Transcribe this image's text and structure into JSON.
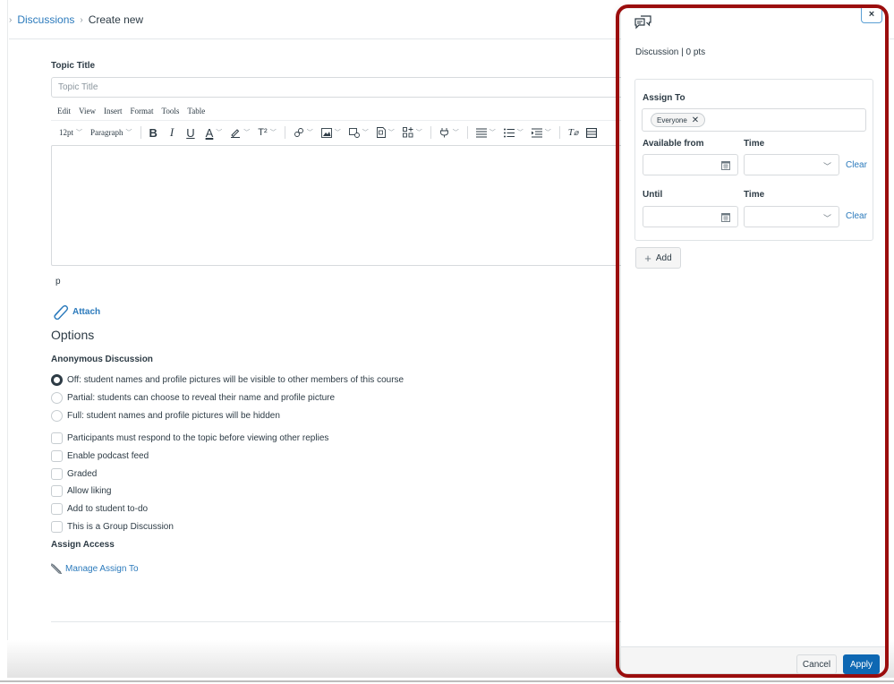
{
  "breadcrumb": {
    "items": [
      {
        "label": "Discussions",
        "link": true
      },
      {
        "label": "Create new",
        "link": false
      }
    ]
  },
  "topic": {
    "label": "Topic Title",
    "placeholder": "Topic Title",
    "value": ""
  },
  "editor": {
    "menus": [
      "Edit",
      "View",
      "Insert",
      "Format",
      "Tools",
      "Table"
    ],
    "font_size": "12pt",
    "block_format": "Paragraph",
    "path": "p",
    "toolbar_icons": [
      "bold-icon",
      "italic-icon",
      "underline-icon",
      "text-color-icon",
      "highlight-icon",
      "superscript-icon",
      "link-icon",
      "image-icon",
      "media-icon",
      "document-icon",
      "apps-icon",
      "embed-icon",
      "align-icon",
      "bullet-list-icon",
      "indent-icon",
      "clear-formatting-icon",
      "table-icon"
    ]
  },
  "attach": {
    "label": "Attach",
    "icon": "paperclip-icon"
  },
  "options": {
    "title": "Options",
    "anonymous": {
      "label": "Anonymous Discussion",
      "choices": [
        {
          "label": "Off: student names and profile pictures will be visible to other members of this course",
          "checked": true
        },
        {
          "label": "Partial: students can choose to reveal their name and profile picture",
          "checked": false
        },
        {
          "label": "Full: student names and profile pictures will be hidden",
          "checked": false
        }
      ]
    },
    "checkboxes": [
      {
        "label": "Participants must respond to the topic before viewing other replies",
        "checked": false
      },
      {
        "label": "Enable podcast feed",
        "checked": false
      },
      {
        "label": "Graded",
        "checked": false
      },
      {
        "label": "Allow liking",
        "checked": false
      },
      {
        "label": "Add to student to-do",
        "checked": false
      },
      {
        "label": "This is a Group Discussion",
        "checked": false
      }
    ]
  },
  "assign_access": {
    "label": "Assign Access",
    "manage_link": "Manage Assign To",
    "icon": "pencil-icon"
  },
  "tray": {
    "close_label": "×",
    "icon": "discussion-icon",
    "subtitle": "Discussion | 0 pts",
    "assign_to_label": "Assign To",
    "assignees": [
      "Everyone"
    ],
    "available_from_label": "Available from",
    "time_label": "Time",
    "until_label": "Until",
    "available_from_value": "",
    "available_from_time": "",
    "until_value": "",
    "until_time": "",
    "clear_label": "Clear",
    "add_label": "Add",
    "cancel_label": "Cancel",
    "apply_label": "Apply",
    "highlight_color": "#9b0d0d",
    "apply_color": "#0e68b3"
  }
}
